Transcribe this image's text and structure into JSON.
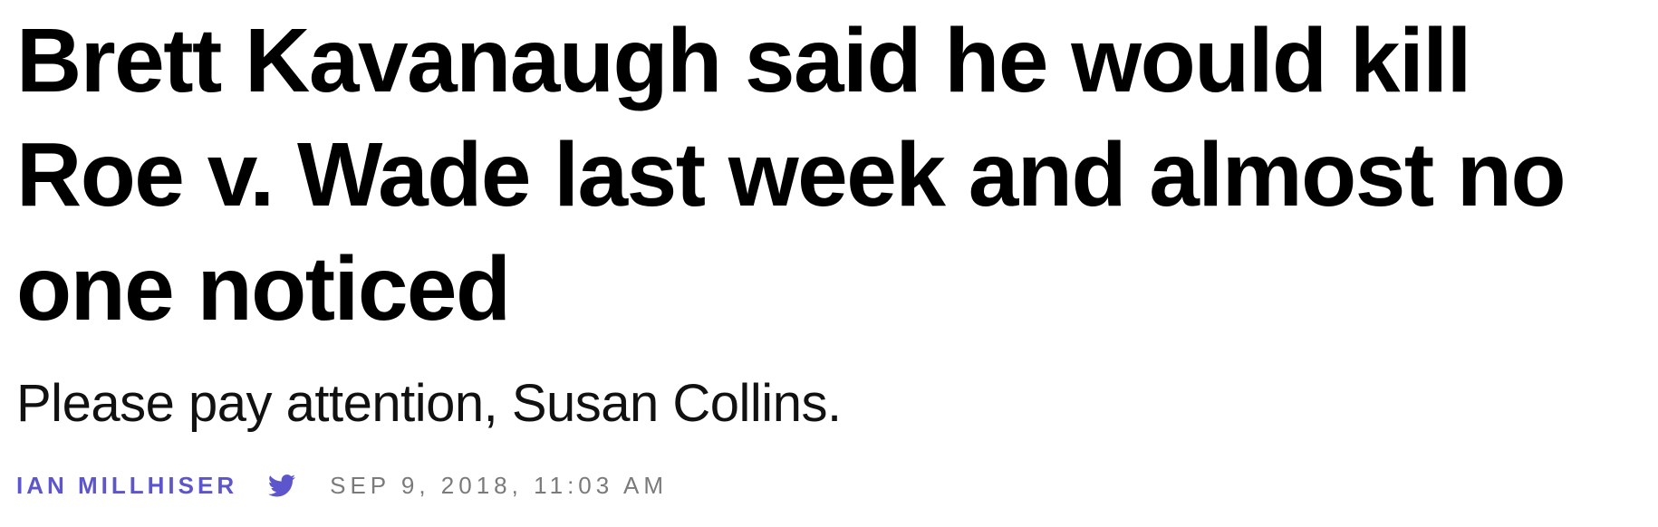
{
  "article": {
    "headline": "Brett Kavanaugh said he would kill Roe v. Wade last week and almost no one noticed",
    "subheadline": "Please pay attention, Susan Collins.",
    "byline": {
      "author": "IAN MILLHISER",
      "twitter_icon": "twitter-bird-icon",
      "timestamp": "SEP 9, 2018, 11:03 AM"
    }
  },
  "colors": {
    "headline": "#000000",
    "accent": "#5c55cc",
    "muted": "#7a7a7a"
  }
}
